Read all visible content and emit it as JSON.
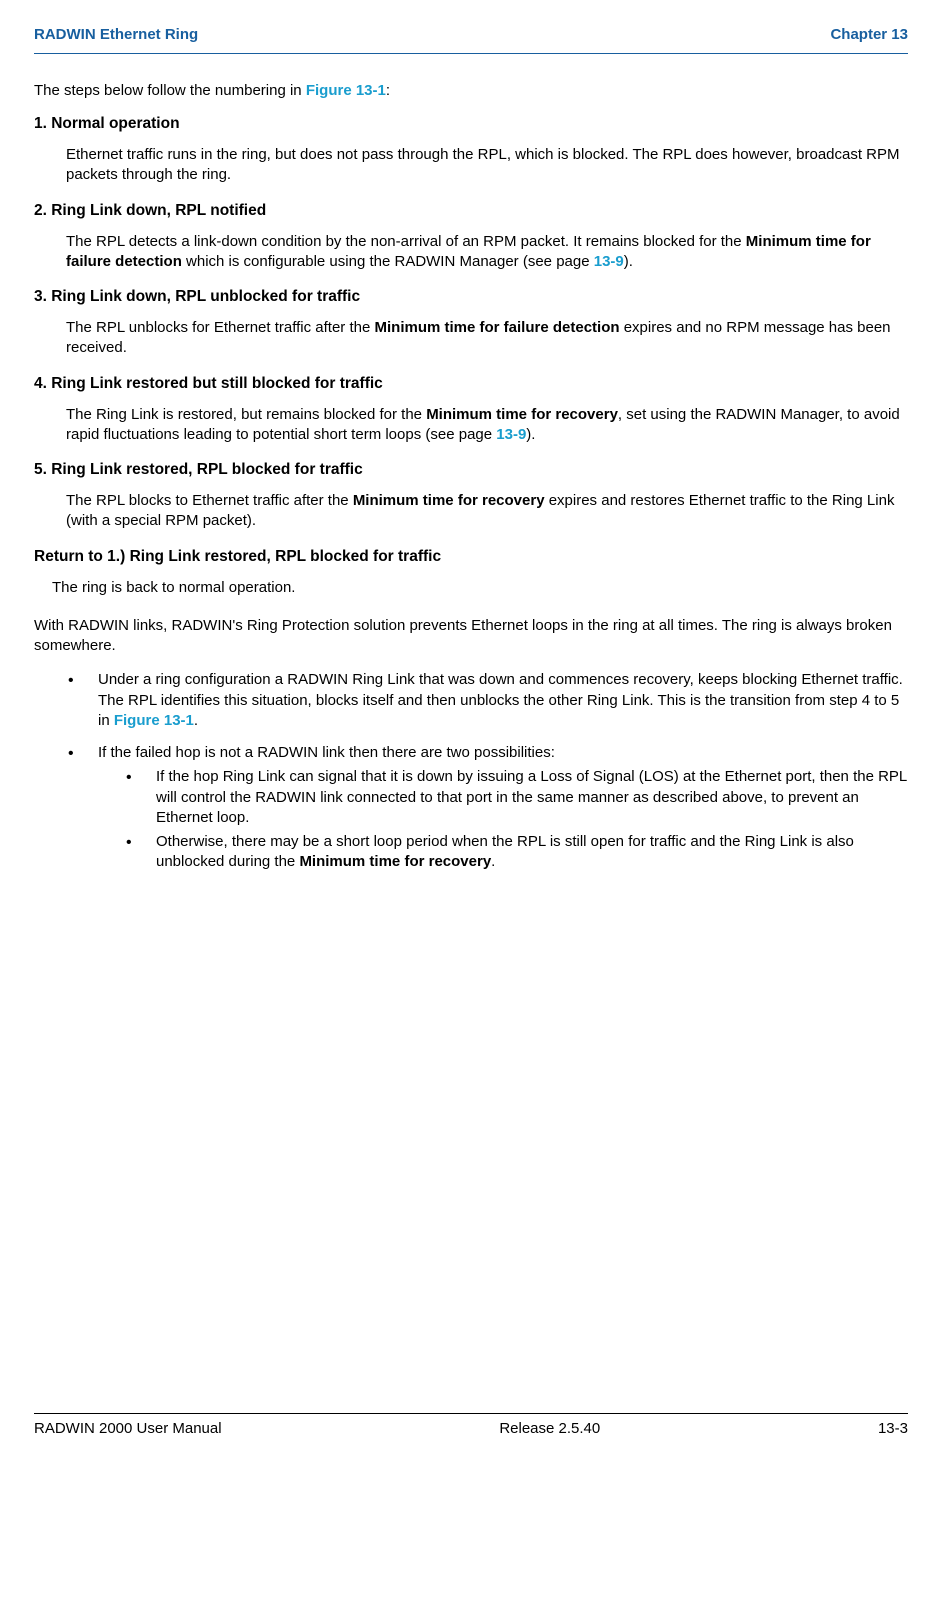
{
  "header": {
    "left": "RADWIN Ethernet Ring",
    "right": "Chapter 13"
  },
  "intro": {
    "pre": "The steps below follow the numbering in ",
    "link": "Figure 13-1",
    "post": ":"
  },
  "steps": {
    "s1": {
      "head": "1. Normal operation",
      "body": "Ethernet traffic runs in the ring, but does not pass through the RPL, which is blocked. The RPL does however, broadcast RPM packets through the ring."
    },
    "s2": {
      "head": "2. Ring Link down, RPL notified",
      "body_pre": "The RPL detects a link-down condition by the non-arrival of an RPM packet. It remains blocked for the ",
      "body_bold": "Minimum time for failure detection",
      "body_mid": " which is configurable using the RADWIN Manager (see page ",
      "body_link": "13-9",
      "body_post": ")."
    },
    "s3": {
      "head": "3. Ring Link down, RPL unblocked for traffic",
      "body_pre": "The RPL unblocks for Ethernet traffic after the ",
      "body_bold": "Minimum time for failure detection",
      "body_post": " expires and no RPM message has been received."
    },
    "s4": {
      "head": "4. Ring Link restored but still blocked for traffic",
      "body_pre": "The Ring Link is restored, but remains blocked for the ",
      "body_bold": "Minimum time for recovery",
      "body_mid": ", set using the RADWIN Manager, to avoid rapid fluctuations leading to potential short term loops (see page ",
      "body_link": "13-9",
      "body_post": ")."
    },
    "s5": {
      "head": "5. Ring Link restored, RPL blocked for traffic",
      "body_pre": "The RPL blocks to Ethernet traffic after the ",
      "body_bold": "Minimum time for recovery",
      "body_post": " expires and restores Ethernet traffic to the Ring Link (with a special RPM packet)."
    }
  },
  "return": {
    "head": "Return to 1.) Ring Link restored, RPL blocked for traffic",
    "body": "The ring is back to normal operation."
  },
  "para": "With RADWIN links, RADWIN's Ring Protection solution prevents Ethernet loops in the ring at all times. The ring is always broken somewhere.",
  "bullets": {
    "b1_pre": "Under a ring configuration a RADWIN Ring Link that was down and commences recovery, keeps blocking Ethernet traffic. The RPL identifies this situation, blocks itself and then unblocks the other Ring Link. This is the transition from step 4 to 5 in ",
    "b1_link": "Figure 13-1",
    "b1_post": ".",
    "b2": "If the failed hop is not a RADWIN link then there are two possibilities:",
    "b2a": "If the hop Ring Link can signal that it is down by issuing a Loss of Signal (LOS) at the Ethernet port, then the RPL will control the RADWIN link connected to that port in the same manner as described above, to prevent an Ethernet loop.",
    "b2b_pre": "Otherwise, there may be a short loop period when the RPL is still open for traffic and the Ring Link is also unblocked during the ",
    "b2b_bold": "Minimum time for recovery",
    "b2b_post": "."
  },
  "footer": {
    "left": "RADWIN 2000 User Manual",
    "center": "Release  2.5.40",
    "right": "13-3"
  }
}
